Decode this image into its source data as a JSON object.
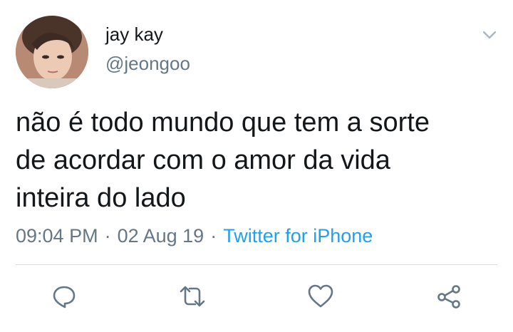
{
  "user": {
    "display_name": "jay kay",
    "handle": "@jeongoo"
  },
  "tweet": {
    "text": "não é todo mundo que tem a sorte\nde acordar com o amor da vida\ninteira do lado",
    "time": "09:04 PM",
    "separator": "·",
    "date": "02 Aug 19",
    "source": "Twitter for iPhone"
  },
  "icons": {
    "menu": "chevron-down-icon",
    "reply": "reply-icon",
    "retweet": "retweet-icon",
    "like": "heart-icon",
    "share": "share-icon"
  },
  "colors": {
    "text": "#14171a",
    "secondary": "#657786",
    "accent": "#1da1f2",
    "icon": "#657786"
  }
}
